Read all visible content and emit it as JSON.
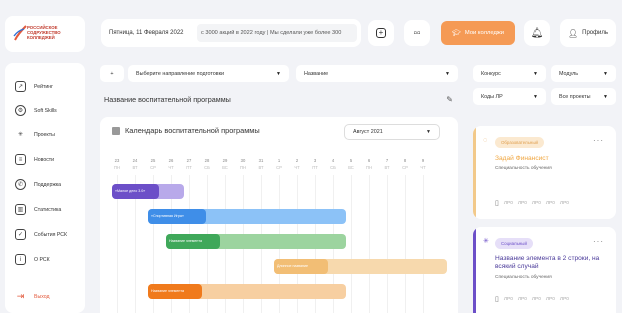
{
  "header": {
    "logo_text": [
      "РОССИЙСКОЕ",
      "СОДРУЖЕСТВО",
      "КОЛЛЕДЖЕЙ"
    ],
    "date": "Пятница, 11 Февраля 2022",
    "news": "с 3000 акций в 2022 году | Мы сделали уже более 300",
    "my_colleges": "Мои колледжи",
    "profile": "Профиль",
    "accent_color": "#f59a55"
  },
  "sidebar": {
    "items": [
      {
        "label": "Рейтинг",
        "icon": "chart-icon"
      },
      {
        "label": "Soft Skills",
        "icon": "gear-icon"
      },
      {
        "label": "Проекты",
        "icon": "loader-icon"
      },
      {
        "label": "Новости",
        "icon": "document-icon"
      },
      {
        "label": "Поддержка",
        "icon": "chat-icon"
      },
      {
        "label": "Статистика",
        "icon": "stats-icon"
      },
      {
        "label": "События РСК",
        "icon": "calendar-check-icon"
      },
      {
        "label": "О РСК",
        "icon": "info-icon"
      }
    ],
    "exit": "Выход"
  },
  "filters": {
    "direction": "Выберите направление подготовки",
    "name": "Название",
    "contest": "Конкурс",
    "module": "Модуль",
    "codes": "Коды ЛР",
    "projects": "Все проекты"
  },
  "program_title": "Название воспитательной программы",
  "calendar": {
    "title": "Календарь воспитательной программы",
    "month": "Август 2021",
    "days": [
      "23",
      "24",
      "25",
      "26",
      "27",
      "28",
      "29",
      "30",
      "31",
      "1",
      "2",
      "3",
      "4",
      "5",
      "6",
      "7",
      "8",
      "9"
    ],
    "weekdays": [
      "ПН",
      "ВТ",
      "СР",
      "ЧТ",
      "ПТ",
      "СБ",
      "ВС",
      "ПН",
      "ВТ",
      "СР",
      "ЧТ",
      "ПТ",
      "СБ",
      "ВС",
      "ПН",
      "ВТ",
      "СР",
      "ЧТ"
    ],
    "bars": [
      {
        "label": "«Малое дело 3.0»",
        "color": "#6c4fc8",
        "light": "#b8a9ea",
        "start": 0,
        "span": 4,
        "lblspan": 2.6,
        "row": 0
      },
      {
        "label": "«Спортивная Игра»",
        "color": "#3f8ee8",
        "light": "#8cc2f7",
        "start": 2,
        "span": 11,
        "lblspan": 3.2,
        "row": 1
      },
      {
        "label": "Название элемента",
        "color": "#3fa85a",
        "light": "#9cd49f",
        "start": 3,
        "span": 10,
        "lblspan": 3.0,
        "row": 2
      },
      {
        "label": "Длинное название",
        "color": "#f2be75",
        "light": "#f7d9ad",
        "start": 9,
        "span": 9.6,
        "lblspan": 3.0,
        "row": 3
      },
      {
        "label": "Название элемента",
        "color": "#f07a1c",
        "light": "#f7cfa1",
        "start": 2,
        "span": 11,
        "lblspan": 3.0,
        "row": 4
      }
    ]
  },
  "cards": [
    {
      "tag": "Образовательный",
      "title": "Задай Финансист",
      "sub": "Специальность обучения",
      "meta": [
        "ЛР0",
        "ЛР0",
        "ЛР0",
        "ЛР0",
        "ЛР0"
      ],
      "side": "#f2c98a",
      "tag_bg": "#fbe9d0",
      "tag_color": "#e0a050",
      "title_color": "#f0a640"
    },
    {
      "tag": "Социальный",
      "title": "Название элемента в 2 строки, на всякий случай",
      "sub": "Специальность обучения",
      "meta": [
        "ЛР0",
        "ЛР0",
        "ЛР0",
        "ЛР0",
        "ЛР0"
      ],
      "side": "#6c4fc8",
      "tag_bg": "#e6dff8",
      "tag_color": "#6c4fc8",
      "title_color": "#4a3a9a"
    }
  ]
}
